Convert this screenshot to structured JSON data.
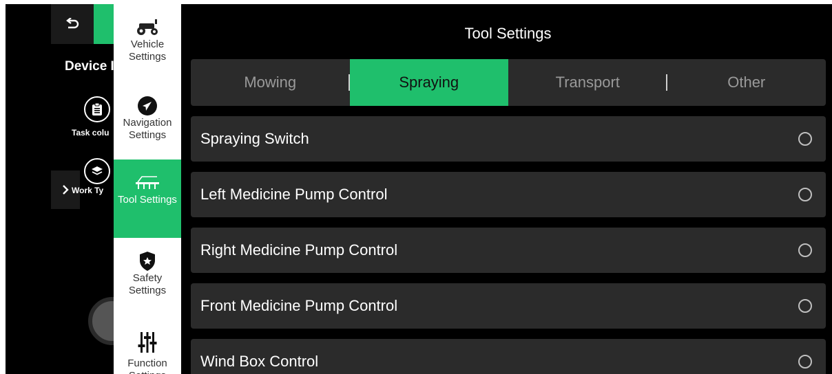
{
  "background": {
    "device_title": "Device I",
    "task_label": "Task colu",
    "work_label": "Work Ty"
  },
  "menu": {
    "items": [
      {
        "label": "Vehicle Settings",
        "icon": "tractor-icon"
      },
      {
        "label": "Navigation Settings",
        "icon": "navigation-arrow-icon"
      },
      {
        "label": "Tool Settings",
        "icon": "sprayer-icon",
        "active": true
      },
      {
        "label": "Safety Settings",
        "icon": "shield-star-icon"
      },
      {
        "label": "Function Settings",
        "icon": "sliders-icon"
      }
    ]
  },
  "main": {
    "title": "Tool Settings",
    "tabs": [
      {
        "label": "Mowing"
      },
      {
        "label": "Spraying",
        "active": true
      },
      {
        "label": "Transport"
      },
      {
        "label": "Other"
      }
    ],
    "rows": [
      {
        "label": "Spraying Switch",
        "selected": false
      },
      {
        "label": "Left Medicine Pump Control",
        "selected": false
      },
      {
        "label": "Right Medicine Pump Control",
        "selected": false
      },
      {
        "label": "Front Medicine Pump Control",
        "selected": false
      },
      {
        "label": "Wind Box Control",
        "selected": false
      }
    ]
  },
  "colors": {
    "accent": "#1fbf6c",
    "background": "#000000",
    "row": "#2b2b2b"
  }
}
